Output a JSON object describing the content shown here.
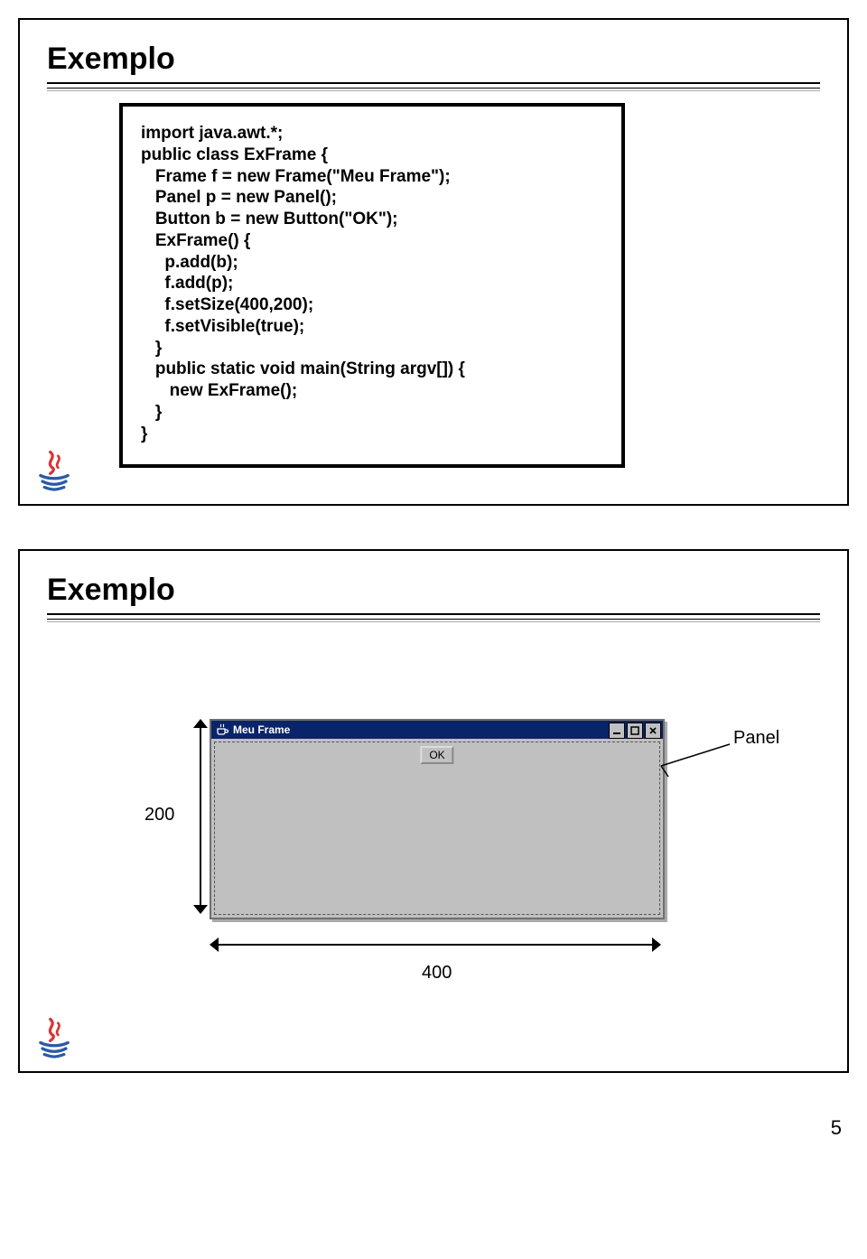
{
  "page_number": "5",
  "slide1": {
    "title": "Exemplo",
    "code": {
      "l01": "import java.awt.*;",
      "l02": "public class ExFrame {",
      "l03": "   Frame f = new Frame(\"Meu Frame\");",
      "l04": "   Panel p = new Panel();",
      "l05": "   Button b = new Button(\"OK\");",
      "l06": "",
      "l07": "   ExFrame() {",
      "l08": "     p.add(b);",
      "l09": "     f.add(p);",
      "l10": "     f.setSize(400,200);",
      "l11": "     f.setVisible(true);",
      "l12": "   }",
      "l13": "",
      "l14": "   public static void main(String argv[]) {",
      "l15": "      new ExFrame();",
      "l16": "   }",
      "l17": "}"
    }
  },
  "slide2": {
    "title": "Exemplo",
    "window_title": "Meu Frame",
    "ok_label": "OK",
    "dim_height": "200",
    "dim_width": "400",
    "panel_label": "Panel"
  }
}
